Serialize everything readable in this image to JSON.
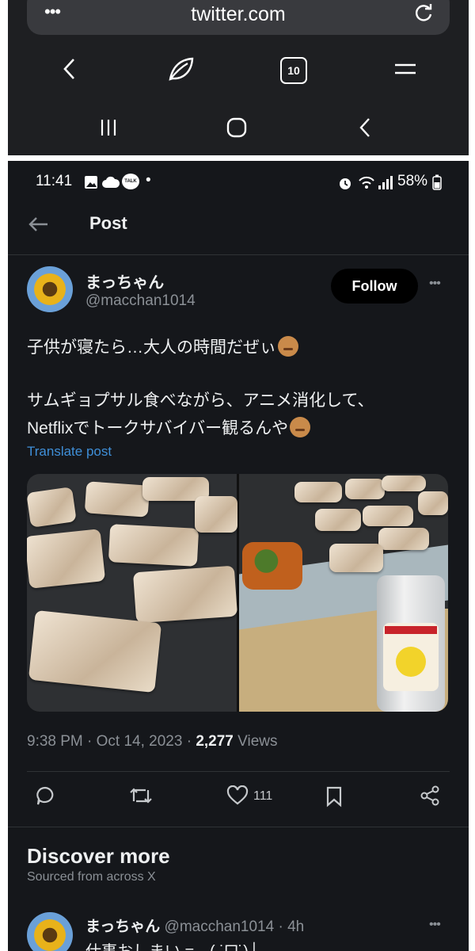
{
  "browser": {
    "menu_label": "•••",
    "url": "twitter.com",
    "tab_count": "10",
    "icons": [
      "reload-icon",
      "back-icon",
      "leaf-icon",
      "tabs-icon",
      "menu-icon",
      "recent-apps-icon",
      "home-icon",
      "nav-back-icon"
    ]
  },
  "status_bar": {
    "time": "11:41",
    "talk_badge": "TALK",
    "dot": "•",
    "battery": "58%"
  },
  "header": {
    "title": "Post"
  },
  "author": {
    "name": "まっちゃん",
    "handle": "@macchan1014",
    "follow_label": "Follow",
    "more_label": "•••"
  },
  "tweet": {
    "line1": "子供が寝たら…大人の時間だぜぃ",
    "line2": "サムギョプサル食べながら、アニメ消化して、",
    "line3": "Netflixでトークサバイバー観るんや",
    "translate": "Translate post"
  },
  "meta": {
    "time_date": "9:38 PM · Oct 14, 2023 · ",
    "views_count": "2,277",
    "views_label": " Views"
  },
  "actions": {
    "like_count": "111"
  },
  "discover": {
    "title": "Discover more",
    "subtitle": "Sourced from across X",
    "item_name": "まっちゃん",
    "item_handle_time": "@macchan1014 · 4h",
    "item_more": "•••",
    "item_text": "仕事おしまい = ┌( ˙ᗜ˙)┘"
  },
  "colors": {
    "screen_bg": "#15171b",
    "link": "#3f8fd8",
    "chrome_bg": "#1e1f22"
  }
}
